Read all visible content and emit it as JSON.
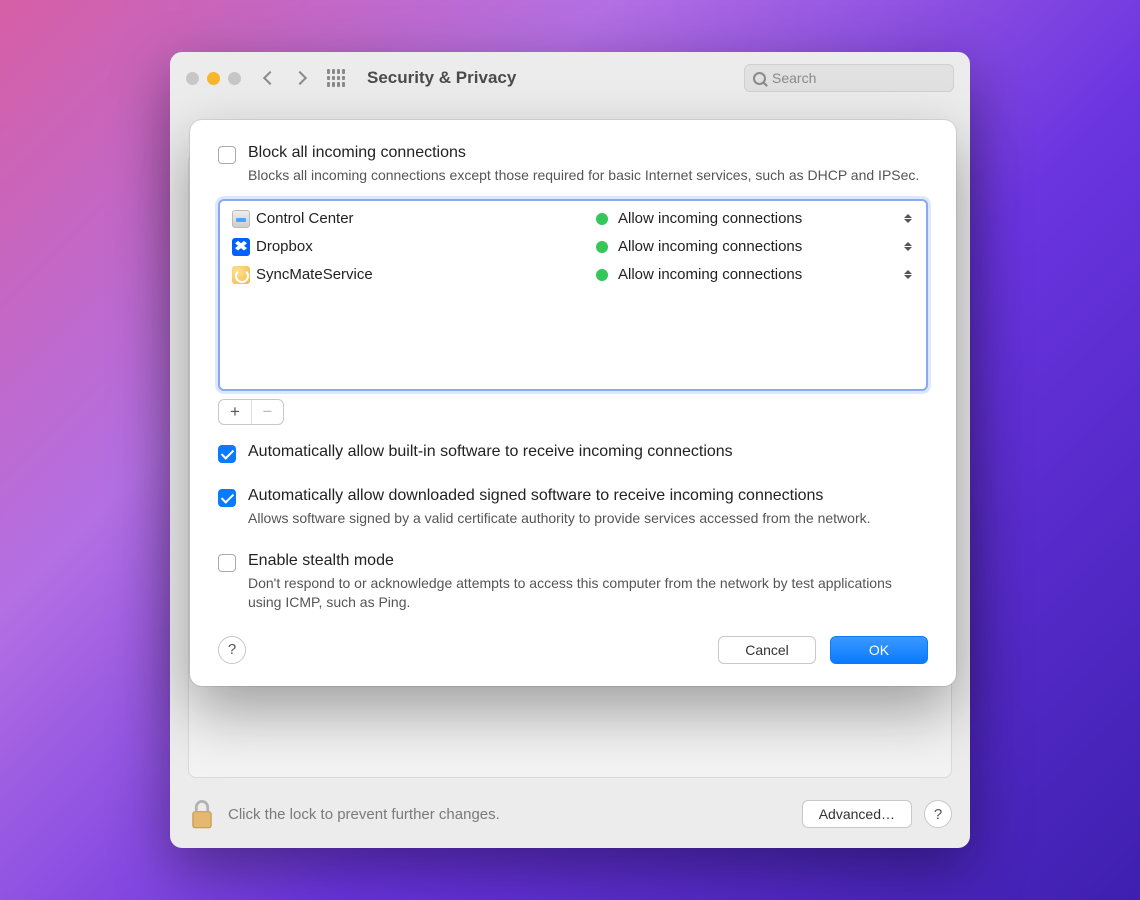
{
  "window": {
    "title": "Security & Privacy",
    "search_placeholder": "Search"
  },
  "bottom": {
    "lock_text": "Click the lock to prevent further changes.",
    "advanced_label": "Advanced…"
  },
  "dialog": {
    "block_all": {
      "title": "Block all incoming connections",
      "desc": "Blocks all incoming connections except those required for basic Internet services, such as DHCP and IPSec.",
      "checked": false
    },
    "apps": [
      {
        "name": "Control Center",
        "status": "Allow incoming connections",
        "icon": "control"
      },
      {
        "name": "Dropbox",
        "status": "Allow incoming connections",
        "icon": "dropbox"
      },
      {
        "name": "SyncMateService",
        "status": "Allow incoming connections",
        "icon": "sync"
      }
    ],
    "auto_builtin": {
      "title": "Automatically allow built-in software to receive incoming connections",
      "checked": true
    },
    "auto_signed": {
      "title": "Automatically allow downloaded signed software to receive incoming connections",
      "desc": "Allows software signed by a valid certificate authority to provide services accessed from the network.",
      "checked": true
    },
    "stealth": {
      "title": "Enable stealth mode",
      "desc": "Don't respond to or acknowledge attempts to access this computer from the network by test applications using ICMP, such as Ping.",
      "checked": false
    },
    "buttons": {
      "cancel": "Cancel",
      "ok": "OK"
    }
  }
}
